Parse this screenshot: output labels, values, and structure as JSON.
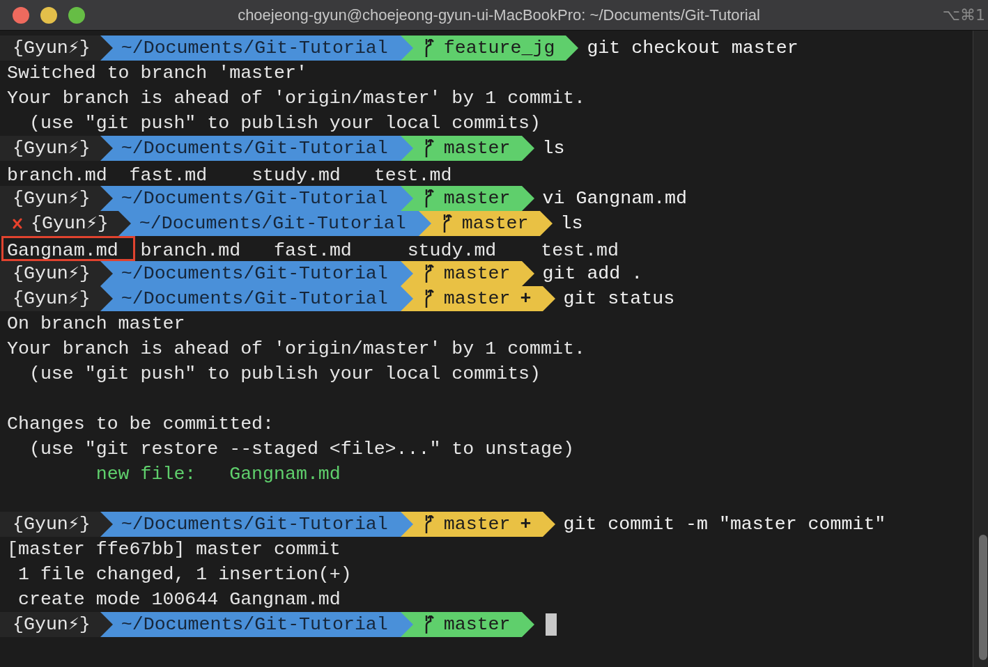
{
  "window": {
    "title": "choejeong-gyun@choejeong-gyun-ui-MacBookPro: ~/Documents/Git-Tutorial",
    "shortcut": "⌥⌘1"
  },
  "lines": [
    {
      "kind": "prompt",
      "failed": false,
      "user": "{Gyun⚡}",
      "path": "~/Documents/Git-Tutorial",
      "branch": "feature_jg",
      "dirty": false,
      "command": "git checkout master",
      "cursor": false
    },
    {
      "kind": "output",
      "text": "Switched to branch 'master'",
      "color": "#e6e6e6"
    },
    {
      "kind": "output",
      "text": "Your branch is ahead of 'origin/master' by 1 commit.",
      "color": "#e6e6e6"
    },
    {
      "kind": "output",
      "text": "  (use \"git push\" to publish your local commits)",
      "color": "#e6e6e6"
    },
    {
      "kind": "prompt",
      "failed": false,
      "user": "{Gyun⚡}",
      "path": "~/Documents/Git-Tutorial",
      "branch": "master",
      "dirty": false,
      "command": "ls",
      "cursor": false
    },
    {
      "kind": "files",
      "files": [
        {
          "name": "branch.md",
          "highlighted": false
        },
        {
          "name": "fast.md",
          "highlighted": false
        },
        {
          "name": "study.md",
          "highlighted": false
        },
        {
          "name": "test.md",
          "highlighted": false
        }
      ]
    },
    {
      "kind": "prompt",
      "failed": false,
      "user": "{Gyun⚡}",
      "path": "~/Documents/Git-Tutorial",
      "branch": "master",
      "dirty": false,
      "command": "vi Gangnam.md",
      "cursor": false
    },
    {
      "kind": "prompt",
      "failed": true,
      "user": "{Gyun⚡}",
      "path": "~/Documents/Git-Tutorial",
      "branch": "master",
      "dirty": true,
      "command": "ls",
      "cursor": false
    },
    {
      "kind": "files",
      "files": [
        {
          "name": "Gangnam.md",
          "highlighted": true
        },
        {
          "name": "branch.md",
          "highlighted": false
        },
        {
          "name": "fast.md",
          "highlighted": false
        },
        {
          "name": "study.md",
          "highlighted": false
        },
        {
          "name": "test.md",
          "highlighted": false
        }
      ]
    },
    {
      "kind": "prompt",
      "failed": false,
      "user": "{Gyun⚡}",
      "path": "~/Documents/Git-Tutorial",
      "branch": "master",
      "dirty": true,
      "command": "git add .",
      "cursor": false
    },
    {
      "kind": "prompt",
      "failed": false,
      "user": "{Gyun⚡}",
      "path": "~/Documents/Git-Tutorial",
      "branch": "master",
      "staged_mark": "+",
      "dirty": true,
      "command": "git status",
      "cursor": false
    },
    {
      "kind": "output",
      "text": "On branch master",
      "color": "#e6e6e6"
    },
    {
      "kind": "output",
      "text": "Your branch is ahead of 'origin/master' by 1 commit.",
      "color": "#e6e6e6"
    },
    {
      "kind": "output",
      "text": "  (use \"git push\" to publish your local commits)",
      "color": "#e6e6e6"
    },
    {
      "kind": "blank"
    },
    {
      "kind": "output",
      "text": "Changes to be committed:",
      "color": "#e6e6e6"
    },
    {
      "kind": "output",
      "text": "  (use \"git restore --staged <file>...\" to unstage)",
      "color": "#e6e6e6"
    },
    {
      "kind": "output",
      "text": "        new file:   Gangnam.md",
      "color": "#5fcf6c"
    },
    {
      "kind": "blank"
    },
    {
      "kind": "prompt",
      "failed": false,
      "user": "{Gyun⚡}",
      "path": "~/Documents/Git-Tutorial",
      "branch": "master",
      "staged_mark": "+",
      "dirty": true,
      "command": "git commit -m \"master commit\"",
      "cursor": false
    },
    {
      "kind": "output",
      "text": "[master ffe67bb] master commit",
      "color": "#e6e6e6"
    },
    {
      "kind": "output",
      "text": " 1 file changed, 1 insertion(+)",
      "color": "#e6e6e6"
    },
    {
      "kind": "output",
      "text": " create mode 100644 Gangnam.md",
      "color": "#e6e6e6"
    },
    {
      "kind": "prompt",
      "failed": false,
      "user": "{Gyun⚡}",
      "path": "~/Documents/Git-Tutorial",
      "branch": "master",
      "dirty": false,
      "cursor": true
    }
  ]
}
